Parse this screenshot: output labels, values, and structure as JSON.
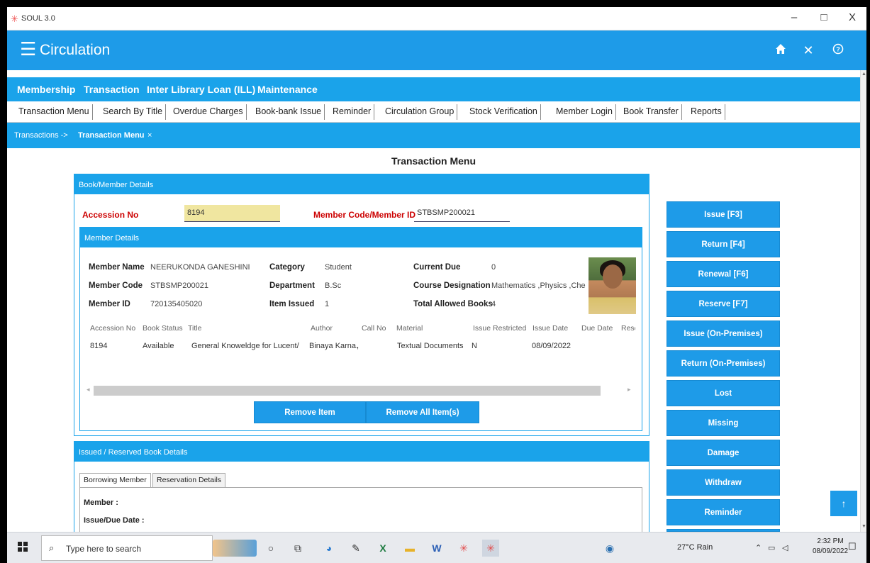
{
  "window": {
    "title": "SOUL 3.0",
    "controls": [
      "–",
      "□",
      "X"
    ]
  },
  "header": {
    "title": "Circulation",
    "icons": [
      "home-icon",
      "close-icon",
      "help-icon"
    ]
  },
  "menubar": {
    "items": [
      "Membership",
      "Transaction",
      "Inter Library Loan (ILL)",
      "Maintenance"
    ]
  },
  "submenu": {
    "items": [
      "Transaction Menu",
      "Search By Title",
      "Overdue Charges",
      "Book-bank Issue",
      "Reminder",
      "Circulation Group",
      "Stock Verification",
      "Member Login",
      "Book Transfer",
      "Reports"
    ]
  },
  "breadcrumb": {
    "parent": "Transactions ->",
    "current": "Transaction Menu",
    "close": "×"
  },
  "page": {
    "title": "Transaction Menu"
  },
  "book_member": {
    "panel_title": "Book/Member Details",
    "accession_label": "Accession No",
    "accession_value": "8194",
    "member_code_label": "Member Code/Member ID",
    "member_code_value": "STBSMP200021"
  },
  "member_details": {
    "panel_title": "Member Details",
    "name_label": "Member Name",
    "name_value": "NEERUKONDA GANESHINI",
    "code_label": "Member Code",
    "code_value": "STBSMP200021",
    "id_label": "Member ID",
    "id_value": "720135405020",
    "category_label": "Category",
    "category_value": "Student",
    "department_label": "Department",
    "department_value": "B.Sc",
    "issued_label": "Item Issued",
    "issued_value": "1",
    "due_label": "Current Due",
    "due_value": "0",
    "course_label": "Course Designation",
    "course_value": "Mathematics ,Physics ,Che",
    "allowed_label": "Total Allowed Books",
    "allowed_value": "4"
  },
  "items_table": {
    "headers": [
      "Accession No",
      "Book Status",
      "Title",
      "Author",
      "Call No",
      "Material",
      "Issue Restricted",
      "Issue Date",
      "Due Date",
      "Rese"
    ],
    "rows": [
      [
        "8194",
        "Available",
        "General Knoweldge for Lucent/",
        "Binaya Karna.",
        ",",
        "Textual Documents",
        "N",
        "08/09/2022"
      ]
    ]
  },
  "buttons": {
    "remove_item": "Remove Item",
    "remove_all": "Remove All Item(s)"
  },
  "side_buttons": [
    "Issue [F3]",
    "Return [F4]",
    "Renewal [F6]",
    "Reserve [F7]",
    "Issue (On-Premises)",
    "Return (On-Premises)",
    "Lost",
    "Missing",
    "Damage",
    "Withdraw",
    "Reminder"
  ],
  "issued_panel": {
    "panel_title": "Issued / Reserved Book Details",
    "tabs": [
      "Borrowing Member",
      "Reservation Details"
    ],
    "member_label": "Member :",
    "issue_due_label": "Issue/Due Date :"
  },
  "taskbar": {
    "search_placeholder": "Type here to search",
    "weather": "27°C  Rain",
    "time": "2:32 PM",
    "date": "08/09/2022"
  },
  "colors": {
    "accent": "#1e9be8",
    "label_red": "#cc0000"
  }
}
